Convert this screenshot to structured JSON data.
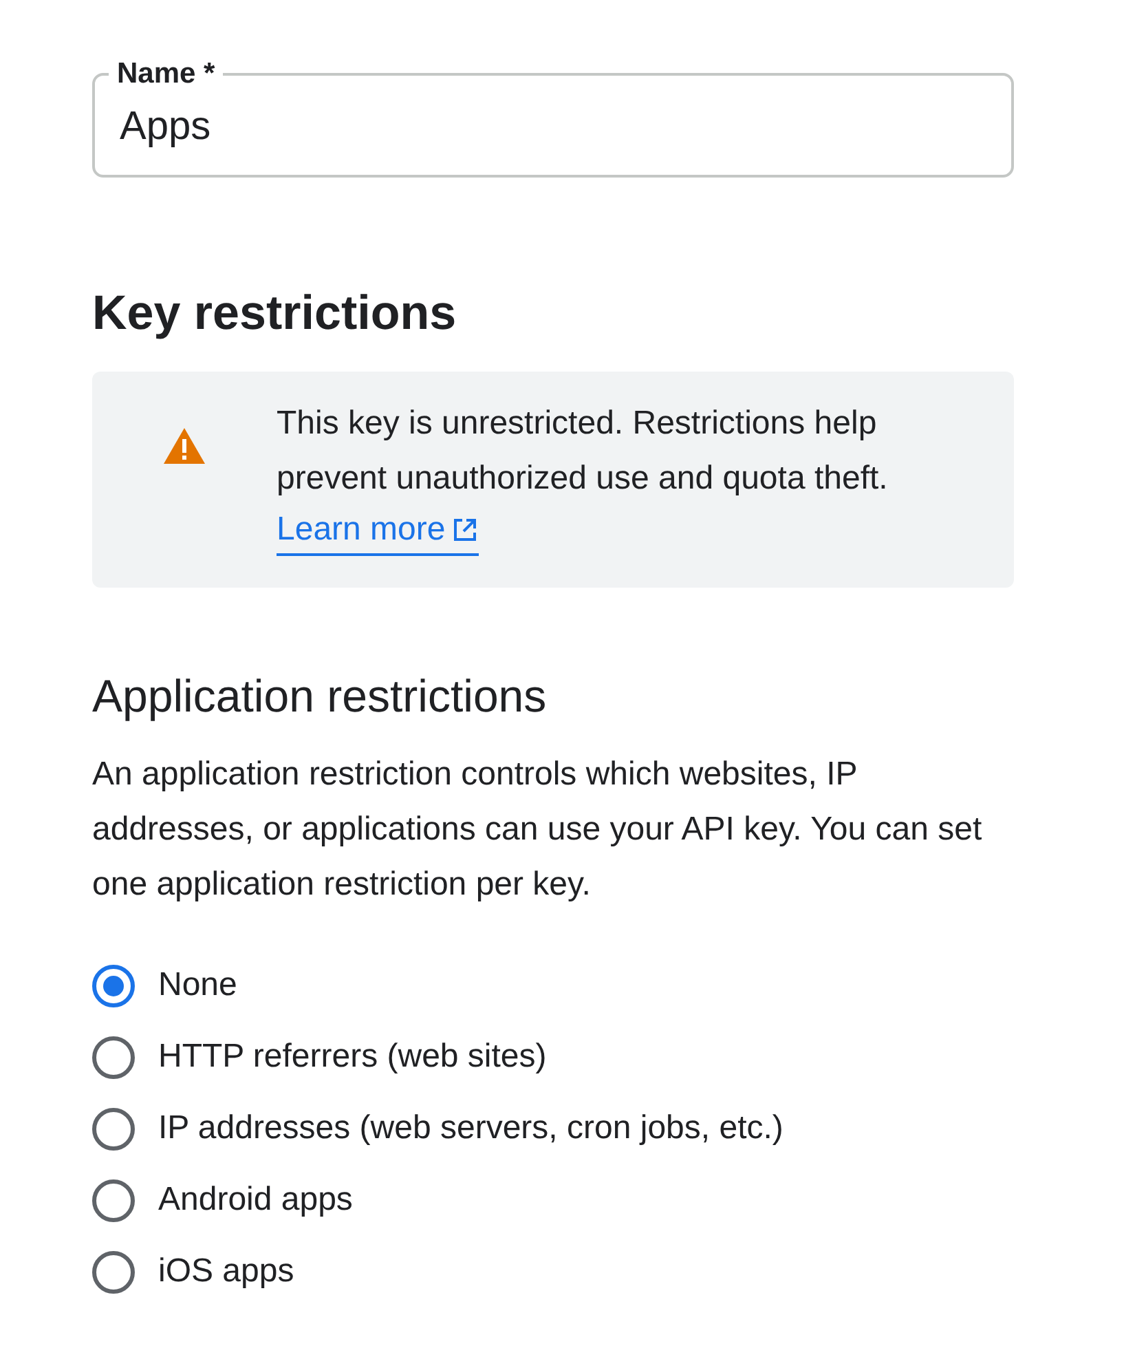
{
  "name_field": {
    "label": "Name *",
    "value": "Apps"
  },
  "key_restrictions": {
    "title": "Key restrictions",
    "warning": {
      "text": "This key is unrestricted. Restrictions help prevent unauthorized use and quota theft.",
      "link": "Learn more"
    }
  },
  "application_restrictions": {
    "title": "Application restrictions",
    "description": "An application restriction controls which websites, IP addresses, or applications can use your API key. You can set one application restriction per key.",
    "options": [
      {
        "label": "None",
        "selected": true
      },
      {
        "label": "HTTP referrers (web sites)",
        "selected": false
      },
      {
        "label": "IP addresses (web servers, cron jobs, etc.)",
        "selected": false
      },
      {
        "label": "Android apps",
        "selected": false
      },
      {
        "label": "iOS apps",
        "selected": false
      }
    ]
  }
}
